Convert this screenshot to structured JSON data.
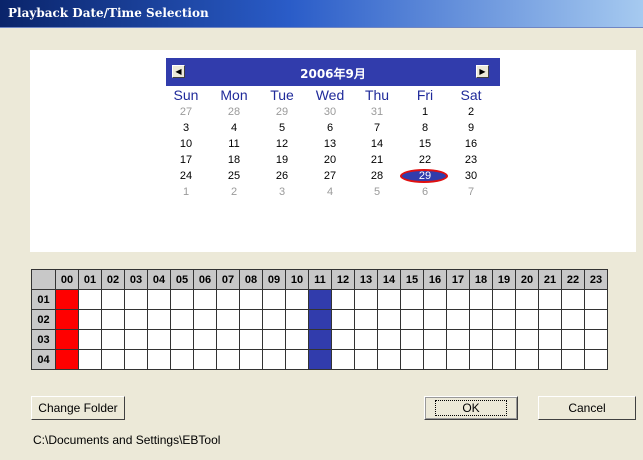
{
  "window": {
    "title": "Playback Date/Time Selection"
  },
  "calendar": {
    "month_label": "2006年9月",
    "prev_glyph": "◀",
    "next_glyph": "▶",
    "weekdays": [
      "Sun",
      "Mon",
      "Tue",
      "Wed",
      "Thu",
      "Fri",
      "Sat"
    ],
    "weeks": [
      [
        [
          "27",
          1
        ],
        [
          "28",
          1
        ],
        [
          "29",
          1
        ],
        [
          "30",
          1
        ],
        [
          "31",
          1
        ],
        [
          "1",
          0
        ],
        [
          "2",
          0
        ]
      ],
      [
        [
          "3",
          0
        ],
        [
          "4",
          0
        ],
        [
          "5",
          0
        ],
        [
          "6",
          0
        ],
        [
          "7",
          0
        ],
        [
          "8",
          0
        ],
        [
          "9",
          0
        ]
      ],
      [
        [
          "10",
          0
        ],
        [
          "11",
          0
        ],
        [
          "12",
          0
        ],
        [
          "13",
          0
        ],
        [
          "14",
          0
        ],
        [
          "15",
          0
        ],
        [
          "16",
          0
        ]
      ],
      [
        [
          "17",
          0
        ],
        [
          "18",
          0
        ],
        [
          "19",
          0
        ],
        [
          "20",
          0
        ],
        [
          "21",
          0
        ],
        [
          "22",
          0
        ],
        [
          "23",
          0
        ]
      ],
      [
        [
          "24",
          0
        ],
        [
          "25",
          0
        ],
        [
          "26",
          0
        ],
        [
          "27",
          0
        ],
        [
          "28",
          0
        ],
        [
          "29",
          2
        ],
        [
          "30",
          0
        ]
      ],
      [
        [
          "1",
          1
        ],
        [
          "2",
          1
        ],
        [
          "3",
          1
        ],
        [
          "4",
          1
        ],
        [
          "5",
          1
        ],
        [
          "6",
          1
        ],
        [
          "7",
          1
        ]
      ]
    ]
  },
  "schedule": {
    "hours": [
      "00",
      "01",
      "02",
      "03",
      "04",
      "05",
      "06",
      "07",
      "08",
      "09",
      "10",
      "11",
      "12",
      "13",
      "14",
      "15",
      "16",
      "17",
      "18",
      "19",
      "20",
      "21",
      "22",
      "23"
    ],
    "rows": [
      "01",
      "02",
      "03",
      "04"
    ],
    "recorded_hours": {
      "00": "#ff0000",
      "11": "#313cac"
    }
  },
  "buttons": {
    "change_folder": "Change Folder",
    "ok": "OK",
    "cancel": "Cancel"
  },
  "folder_path": "C:\\Documents and Settings\\EBTool"
}
